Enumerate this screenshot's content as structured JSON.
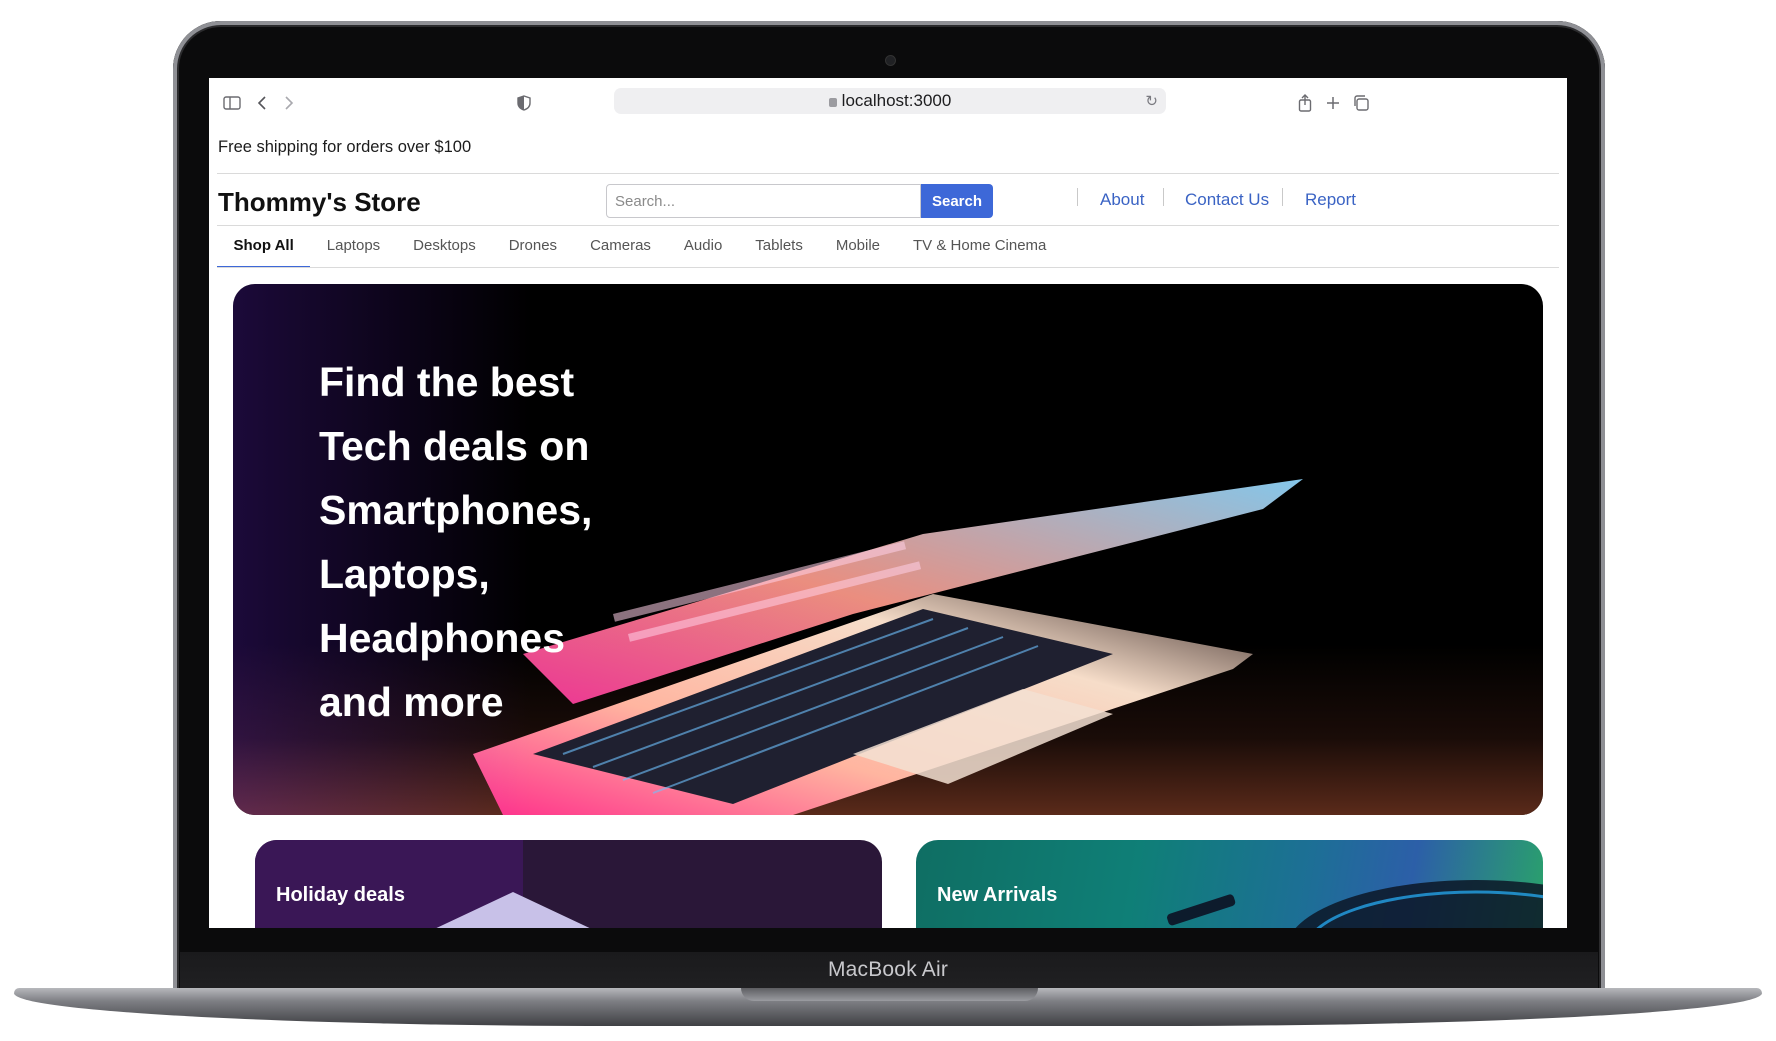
{
  "device": {
    "model_label": "MacBook Air"
  },
  "browser": {
    "url": "localhost:3000",
    "icons": [
      "sidebar-icon",
      "back-icon",
      "forward-icon",
      "shield-icon",
      "lock-icon",
      "reload-icon",
      "share-icon",
      "new-tab-icon",
      "tabs-overview-icon"
    ]
  },
  "promo": {
    "text": "Free shipping for orders over $100"
  },
  "header": {
    "brand": "Thommy's Store",
    "search": {
      "placeholder": "Search...",
      "value": "",
      "button_label": "Search"
    },
    "nav": {
      "about": "About",
      "contact": "Contact Us",
      "report": "Report"
    }
  },
  "categories": [
    "Shop All",
    "Laptops",
    "Desktops",
    "Drones",
    "Cameras",
    "Audio",
    "Tablets",
    "Mobile",
    "TV & Home Cinema"
  ],
  "active_category": "Shop All",
  "hero": {
    "title_lines": [
      "Find the best",
      "Tech deals on",
      "Smartphones,",
      "Laptops,",
      "Headphones",
      "and more"
    ]
  },
  "cards": {
    "holiday": "Holiday deals",
    "new_arrivals": "New Arrivals"
  },
  "colors": {
    "accent": "#3d68d8",
    "link": "#3a63c4",
    "hero_bg": "#000000"
  }
}
